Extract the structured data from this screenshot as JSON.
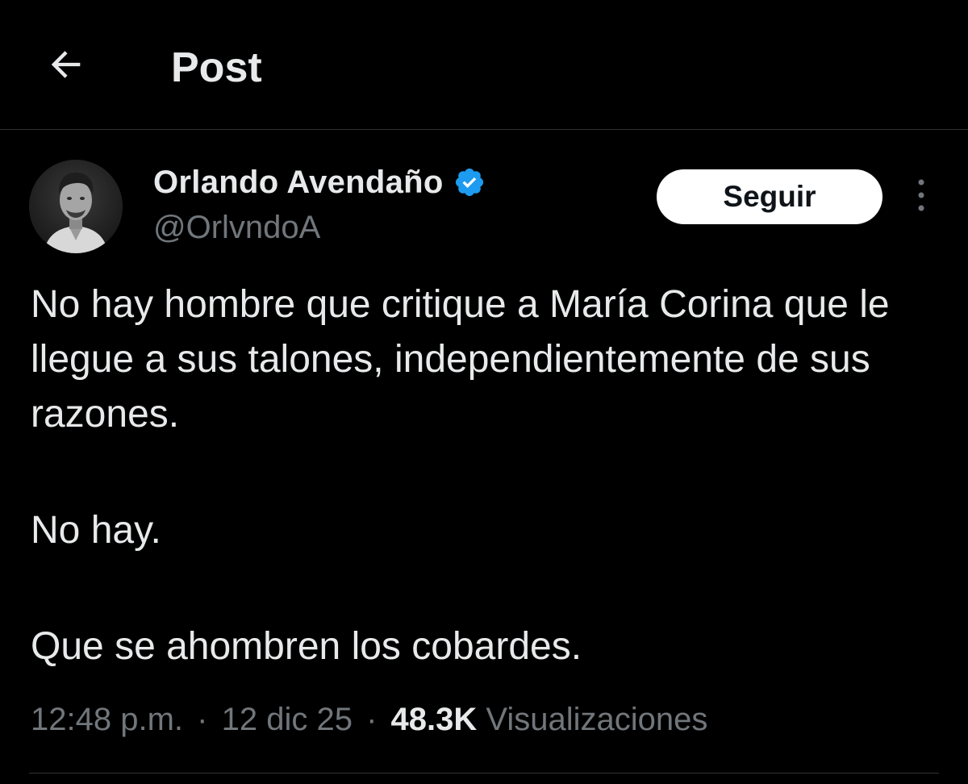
{
  "header": {
    "back_icon": "arrow-left-icon",
    "title": "Post"
  },
  "author": {
    "name": "Orlando Avendaño",
    "handle": "@OrlvndoA",
    "verified_icon": "verified-badge-icon",
    "verified_color": "#1d9bf0",
    "avatar": "profile-photo"
  },
  "actions": {
    "follow_label": "Seguir",
    "more_icon": "more-vertical-icon"
  },
  "tweet": {
    "lines": [
      "No hay hombre que critique a María Corina que le llegue a sus talones, independientemente de sus razones.",
      "No hay.",
      "Que se ahombren los cobardes."
    ]
  },
  "meta": {
    "time": "12:48 p.m.",
    "separator": "·",
    "date": "12 dic 25",
    "views_count": "48.3K",
    "views_label": "Visualizaciones"
  },
  "colors": {
    "background": "#000000",
    "text_primary": "#e7e9ea",
    "text_secondary": "#71767b",
    "divider": "#2f3336",
    "button_bg": "#ffffff",
    "button_text": "#0f1419"
  }
}
